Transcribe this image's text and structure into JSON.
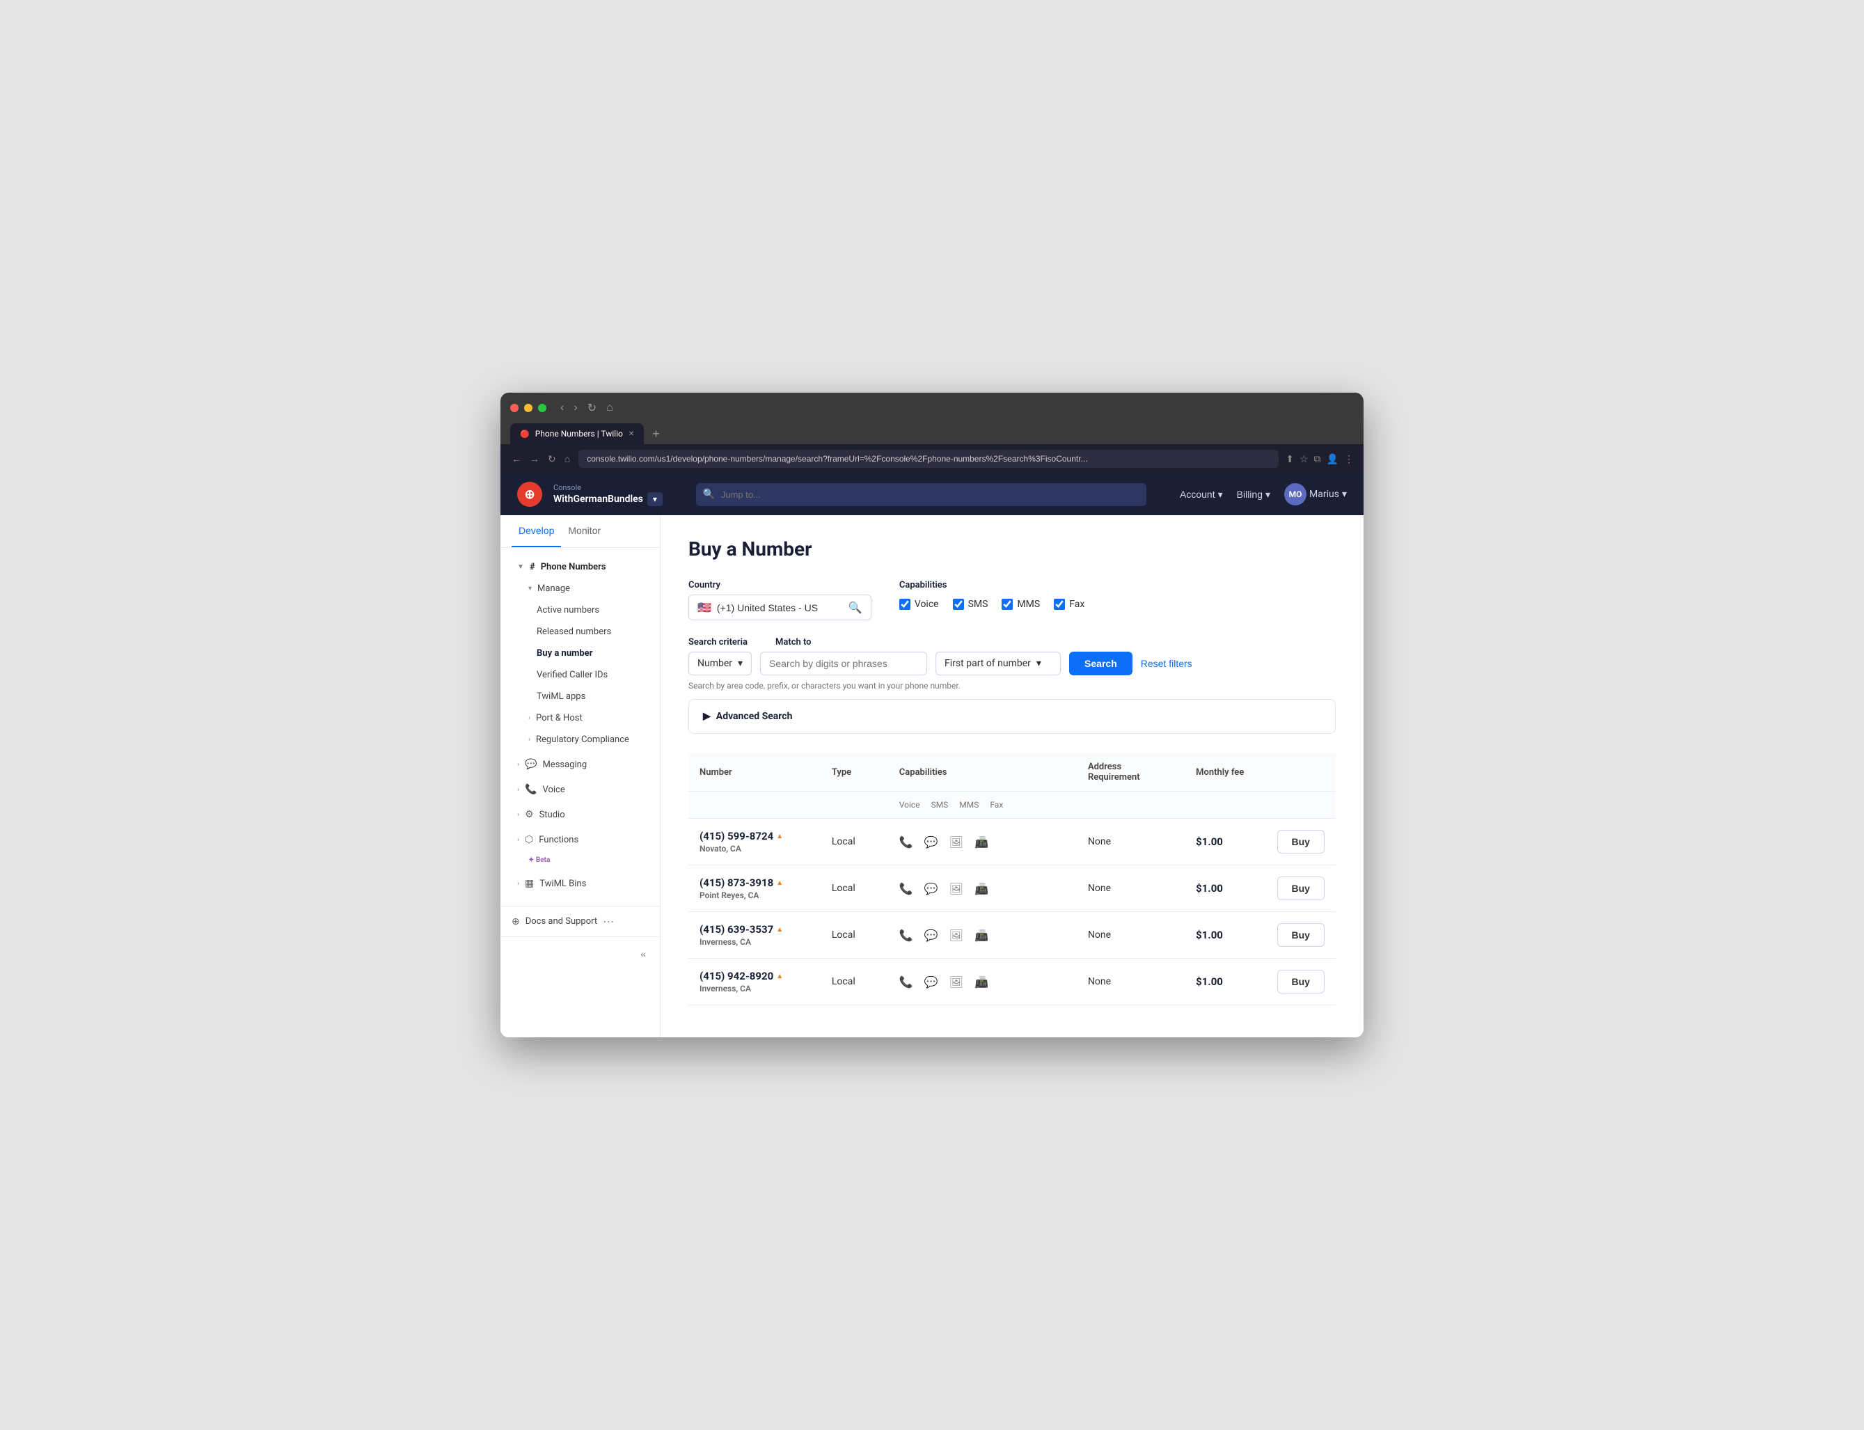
{
  "browser": {
    "tab_label": "Phone Numbers | Twilio",
    "tab_favicon": "🔴",
    "url": "console.twilio.com/us1/develop/phone-numbers/manage/search?frameUrl=%2Fconsole%2Fphone-numbers%2Fsearch%3FisoCountr...",
    "new_tab_icon": "+"
  },
  "header": {
    "console_label": "Console",
    "account_name": "WithGermanBundles",
    "dropdown_icon": "▾",
    "search_placeholder": "Jump to...",
    "account_label": "Account",
    "billing_label": "Billing",
    "user_initials": "MO",
    "user_name": "Marius",
    "user_dropdown": "▾"
  },
  "sidebar": {
    "tab_develop": "Develop",
    "tab_monitor": "Monitor",
    "phone_numbers_label": "Phone Numbers",
    "manage_label": "Manage",
    "active_numbers_label": "Active numbers",
    "released_numbers_label": "Released numbers",
    "buy_number_label": "Buy a number",
    "verified_caller_ids_label": "Verified Caller IDs",
    "twiml_apps_label": "TwiML apps",
    "port_host_label": "Port & Host",
    "regulatory_label": "Regulatory Compliance",
    "messaging_label": "Messaging",
    "voice_label": "Voice",
    "studio_label": "Studio",
    "functions_label": "Functions",
    "beta_label": "Beta",
    "twiml_bins_label": "TwiML Bins",
    "docs_support_label": "Docs and Support",
    "collapse_label": "«"
  },
  "page": {
    "title": "Buy a Number",
    "country_label": "Country",
    "country_value": "(+1) United States - US",
    "country_flag": "🇺🇸",
    "capabilities_label": "Capabilities",
    "cap_voice": "Voice",
    "cap_sms": "SMS",
    "cap_mms": "MMS",
    "cap_fax": "Fax",
    "search_criteria_label": "Search criteria",
    "match_to_label": "Match to",
    "criteria_option": "Number",
    "criteria_arrow": "▾",
    "search_placeholder": "Search by digits or phrases",
    "match_option": "First part of number",
    "match_arrow": "▾",
    "search_button": "Search",
    "reset_button": "Reset filters",
    "search_hint": "Search by area code, prefix, or characters you want in your phone number.",
    "advanced_search_label": "Advanced Search",
    "advanced_arrow": "▶",
    "table": {
      "col_number": "Number",
      "col_type": "Type",
      "col_capabilities": "Capabilities",
      "col_address": "Address Requirement",
      "col_fee": "Monthly fee",
      "col_action": "",
      "sub_voice": "Voice",
      "sub_sms": "SMS",
      "sub_mms": "MMS",
      "sub_fax": "Fax",
      "rows": [
        {
          "number": "(415) 599-8724",
          "location": "Novato, CA",
          "type": "Local",
          "address": "None",
          "fee": "$1.00",
          "buy": "Buy"
        },
        {
          "number": "(415) 873-3918",
          "location": "Point Reyes, CA",
          "type": "Local",
          "address": "None",
          "fee": "$1.00",
          "buy": "Buy"
        },
        {
          "number": "(415) 639-3537",
          "location": "Inverness, CA",
          "type": "Local",
          "address": "None",
          "fee": "$1.00",
          "buy": "Buy"
        },
        {
          "number": "(415) 942-8920",
          "location": "Inverness, CA",
          "type": "Local",
          "address": "None",
          "fee": "$1.00",
          "buy": "Buy"
        }
      ]
    }
  }
}
